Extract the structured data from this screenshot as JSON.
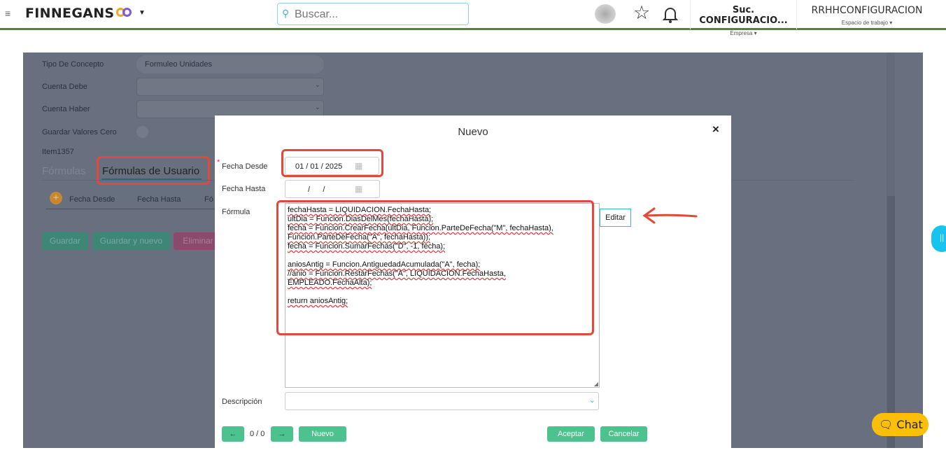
{
  "header": {
    "brand": "FINNEGANS",
    "search_placeholder": "Buscar...",
    "company": "Suc. CONFIGURACIO...",
    "company_label": "Empresa",
    "workspace": "RRHHCONFIGURACION",
    "workspace_label": "Espacio de trabajo"
  },
  "background_form": {
    "fields": [
      {
        "label": "Tipo De Concepto",
        "value": "Formuleo Unidades"
      },
      {
        "label": "Cuenta Debe",
        "value": ""
      },
      {
        "label": "Cuenta Haber",
        "value": ""
      },
      {
        "label": "Guardar Valores Cero",
        "value": ""
      },
      {
        "label": "Item1357",
        "value": ""
      }
    ],
    "tabs": [
      "Fórmulas",
      "Fórmulas de Usuario"
    ],
    "columns": [
      "Fecha Desde",
      "Fecha Hasta",
      "Fó"
    ],
    "buttons": {
      "save": "Guardar",
      "save_new": "Guardar y nuevo",
      "delete": "Eliminar"
    }
  },
  "modal": {
    "title": "Nuevo",
    "close": "×",
    "fecha_desde_label": "Fecha Desde",
    "fecha_desde_value": "01 / 01 / 2025",
    "required_mark": "*",
    "fecha_hasta_label": "Fecha Hasta",
    "fecha_hasta_value": "/      /",
    "formula_label": "Fórmula",
    "formula_lines": [
      "fechaHasta = LIQUIDACION.FechaHasta;",
      "ultDia = Funcion.DiasDelMes(fechaHasta);",
      "fecha = Funcion.CrearFecha(ultDia, Funcion.ParteDeFecha(\"M\", fechaHasta),",
      "Funcion.ParteDeFecha(\"A\", fechaHasta));",
      "fecha = Funcion.SumarFechas(\"D\", -1, fecha);",
      "",
      "aniosAntig = Funcion.AntiguedadAcumulada(\"A\", fecha);",
      "//anio = Funcion.RestarFechas(\"A\", LIQUIDACION.FechaHasta,",
      "EMPLEADO.FechaAlta);",
      "",
      "return aniosAntig;"
    ],
    "edit_button": "Editar",
    "descripcion_label": "Descripción",
    "pager": "0 / 0",
    "new_button": "Nuevo",
    "accept_button": "Aceptar",
    "cancel_button": "Cancelar"
  },
  "chat_button": "Chat",
  "colors": {
    "accent_green": "#4cc38f",
    "annotation_red": "#e5473b",
    "chat_yellow": "#fbbf0a"
  }
}
